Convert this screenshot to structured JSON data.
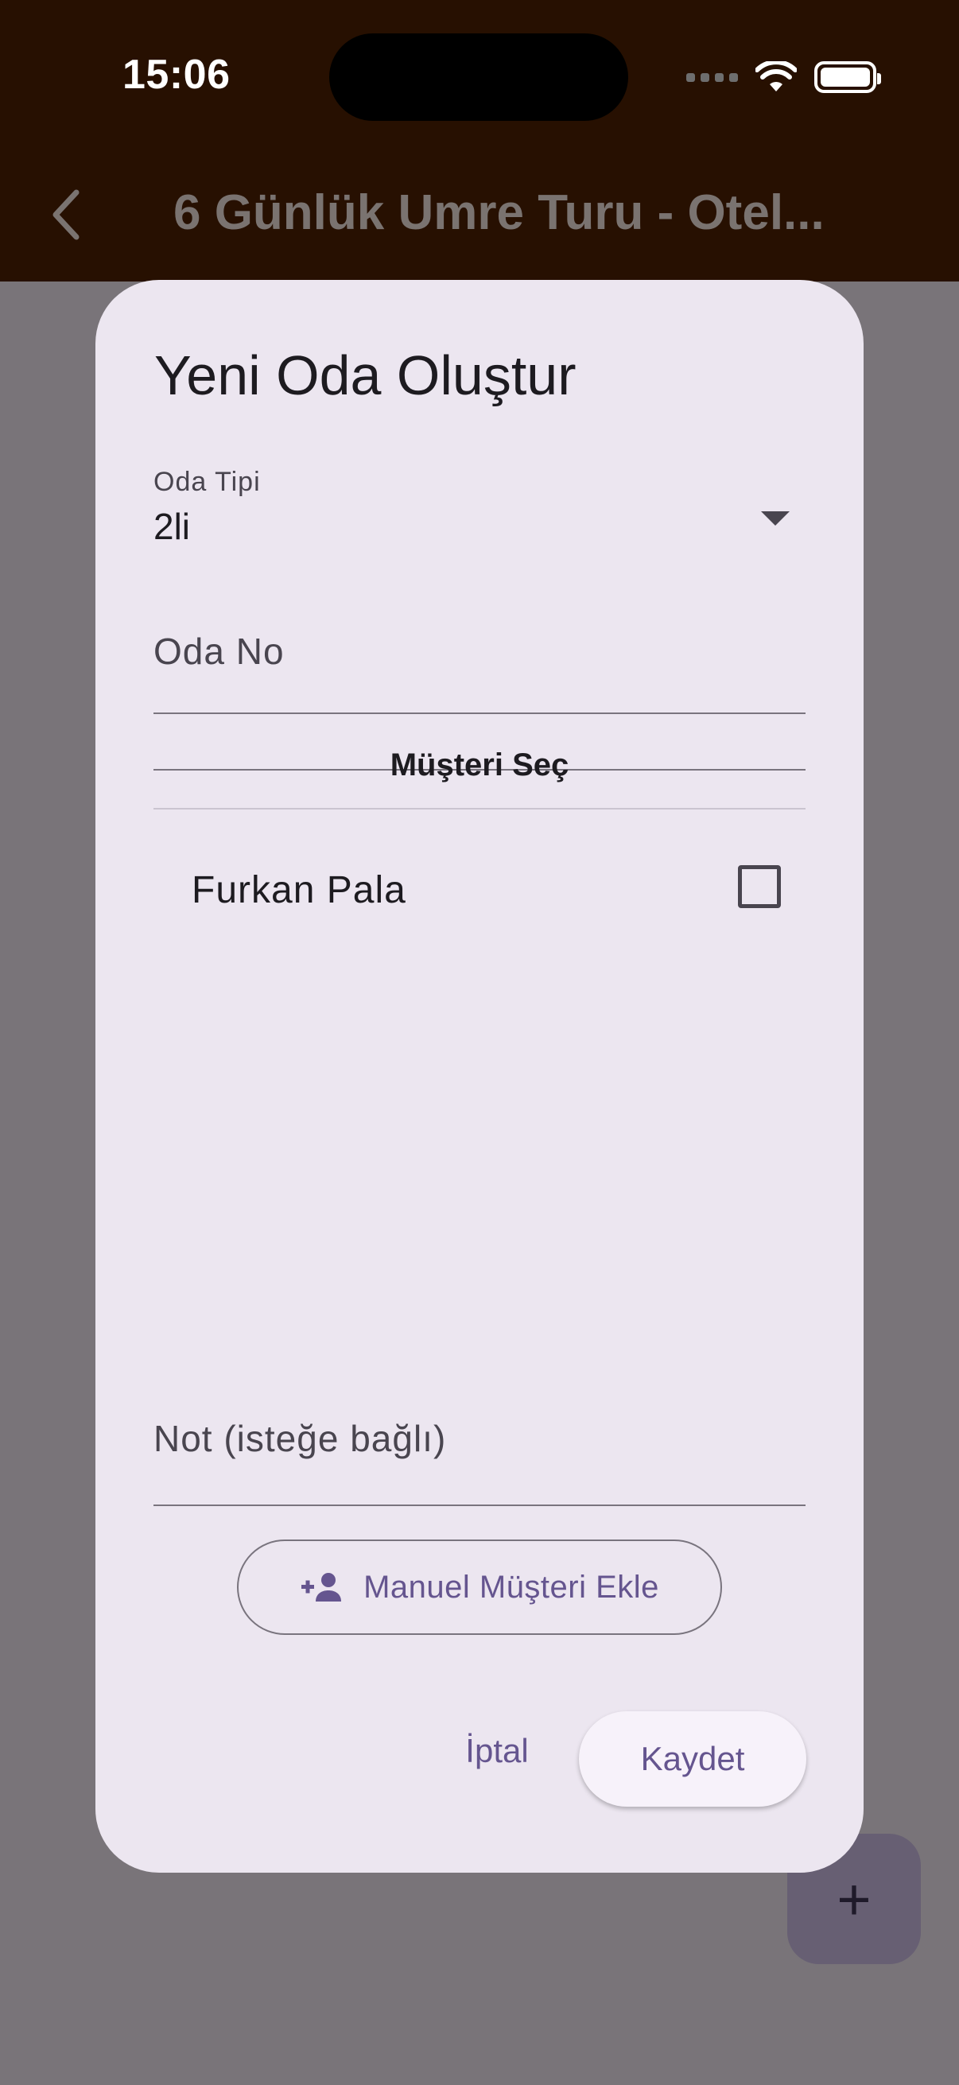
{
  "status_bar": {
    "time": "15:06"
  },
  "nav": {
    "title": "6 Günlük Umre Turu - Otel..."
  },
  "dialog": {
    "title": "Yeni Oda Oluştur",
    "room_type": {
      "label": "Oda Tipi",
      "value": "2li"
    },
    "room_no": {
      "placeholder": "Oda No"
    },
    "customers_header": "Müşteri Seç",
    "customers": [
      {
        "name": "Furkan Pala",
        "checked": false
      }
    ],
    "note": {
      "placeholder": "Not (isteğe bağlı)"
    },
    "manual_add_label": "Manuel Müşteri Ekle",
    "cancel_label": "İptal",
    "save_label": "Kaydet"
  },
  "fab": {
    "icon": "plus-icon",
    "label": "+"
  },
  "colors": {
    "app_bar": "#271001",
    "scrim": "#797479",
    "dialog_bg": "#ece6f0",
    "accent": "#65558f"
  }
}
